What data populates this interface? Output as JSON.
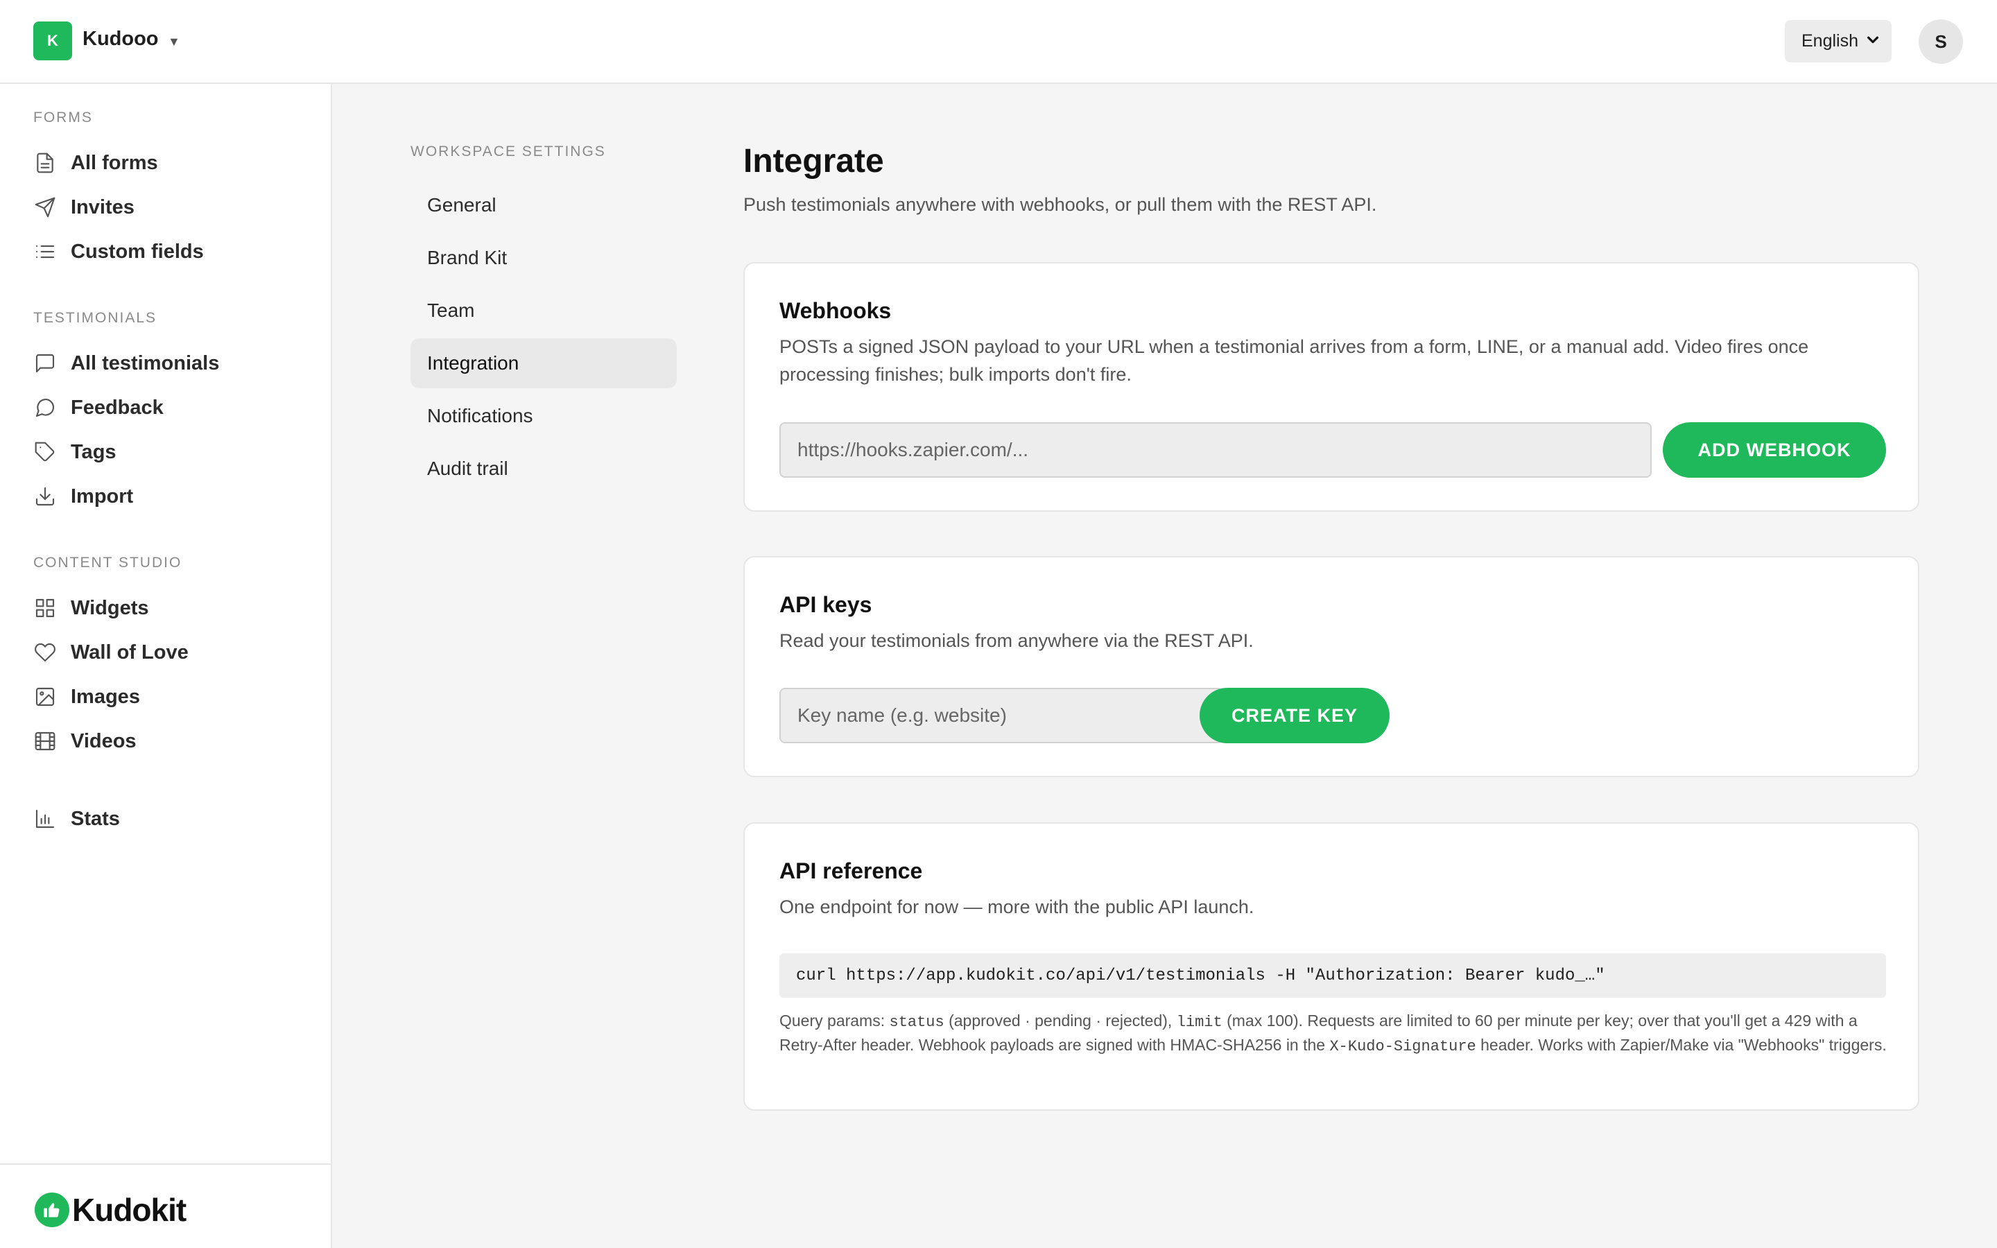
{
  "topbar": {
    "workspace_initial": "K",
    "workspace_name": "Kudooo",
    "language": "English",
    "avatar_initial": "S"
  },
  "sidebar": {
    "sections": [
      {
        "label": "FORMS",
        "items": [
          {
            "label": "All forms",
            "icon": "document-icon"
          },
          {
            "label": "Invites",
            "icon": "send-icon"
          },
          {
            "label": "Custom fields",
            "icon": "list-icon"
          }
        ]
      },
      {
        "label": "TESTIMONIALS",
        "items": [
          {
            "label": "All testimonials",
            "icon": "message-square-icon"
          },
          {
            "label": "Feedback",
            "icon": "message-circle-icon"
          },
          {
            "label": "Tags",
            "icon": "tag-icon"
          },
          {
            "label": "Import",
            "icon": "download-icon"
          }
        ]
      },
      {
        "label": "CONTENT STUDIO",
        "items": [
          {
            "label": "Widgets",
            "icon": "grid-icon"
          },
          {
            "label": "Wall of Love",
            "icon": "heart-icon"
          },
          {
            "label": "Images",
            "icon": "image-icon"
          },
          {
            "label": "Videos",
            "icon": "film-icon"
          }
        ]
      }
    ],
    "stats_label": "Stats",
    "brand": "Kudokit"
  },
  "settings_nav": {
    "title": "WORKSPACE SETTINGS",
    "items": [
      "General",
      "Brand Kit",
      "Team",
      "Integration",
      "Notifications",
      "Audit trail"
    ],
    "active": "Integration"
  },
  "main": {
    "title": "Integrate",
    "subtitle": "Push testimonials anywhere with webhooks, or pull them with the REST API.",
    "webhooks": {
      "title": "Webhooks",
      "description": "POSTs a signed JSON payload to your URL when a testimonial arrives from a form, LINE, or a manual add. Video fires once processing finishes; bulk imports don't fire.",
      "placeholder": "https://hooks.zapier.com/...",
      "button": "ADD WEBHOOK"
    },
    "api_keys": {
      "title": "API keys",
      "description": "Read your testimonials from anywhere via the REST API.",
      "placeholder": "Key name (e.g. website)",
      "button": "CREATE KEY"
    },
    "api_reference": {
      "title": "API reference",
      "description": "One endpoint for now — more with the public API launch.",
      "code": "curl https://app.kudokit.co/api/v1/testimonials -H \"Authorization: Bearer kudo_…\"",
      "notes": {
        "t1": "Query params: ",
        "c1": "status",
        "t2": " (approved · pending · rejected), ",
        "c2": "limit",
        "t3": " (max 100). Requests are limited to 60 per minute per key; over that you'll get a 429 with a Retry-After header. Webhook payloads are signed with HMAC-SHA256 in the ",
        "c3": "X-Kudo-Signature",
        "t4": " header. Works with Zapier/Make via \"Webhooks\" triggers."
      }
    }
  },
  "colors": {
    "accent": "#1fb85a",
    "background": "#f5f5f5",
    "surface": "#ffffff",
    "border": "#e6e6e6"
  }
}
